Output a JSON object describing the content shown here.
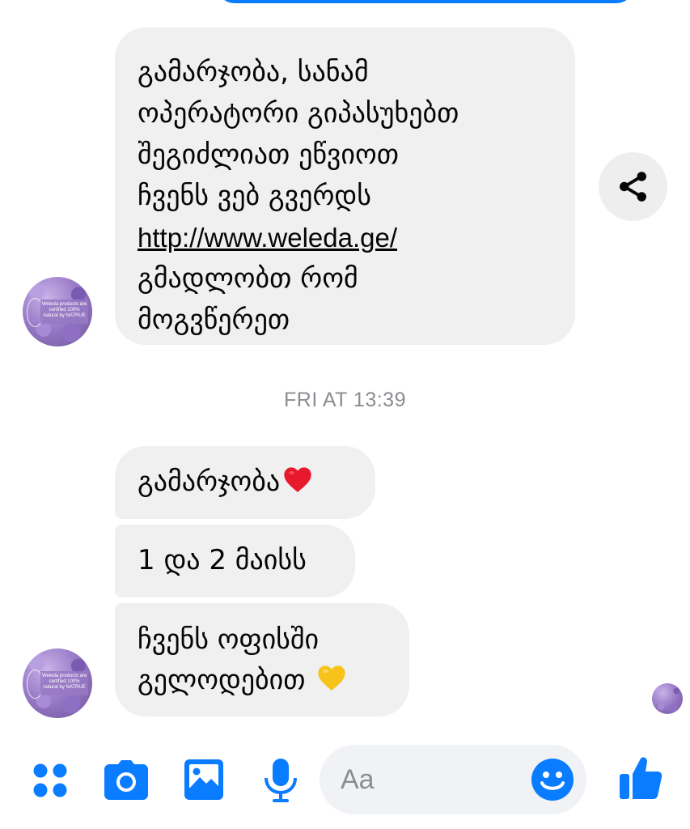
{
  "messages": {
    "auto_reply": {
      "lines": [
        "გამარჯობა, სანამ",
        "ოპერატორი გიპასუხებთ",
        "შეგიძლიათ ეწვიოთ",
        "ჩვენს ვებ გვერდს",
        "http://www.weleda.ge/",
        "გმადლობთ რომ",
        "მოგვწერეთ"
      ]
    },
    "timestamp": "FRI AT 13:39",
    "thread": [
      {
        "text": "გამარჯობა",
        "emoji": "red-heart"
      },
      {
        "text": "1 და 2 მაისს"
      },
      {
        "lines": [
          "ჩვენს ოფისში",
          "გელოდებით"
        ],
        "emoji": "yellow-heart"
      }
    ]
  },
  "avatar": {
    "badge_lines": [
      "Weleda products are",
      "certified 100%",
      "natural by NATRUE"
    ]
  },
  "composer": {
    "placeholder": "Aa"
  },
  "colors": {
    "accent": "#0a7cff",
    "bubble_bg": "#f0f0f0",
    "timestamp": "#8a8d91",
    "red_heart": "#e8192c",
    "yellow_heart": "#f7c31b"
  }
}
